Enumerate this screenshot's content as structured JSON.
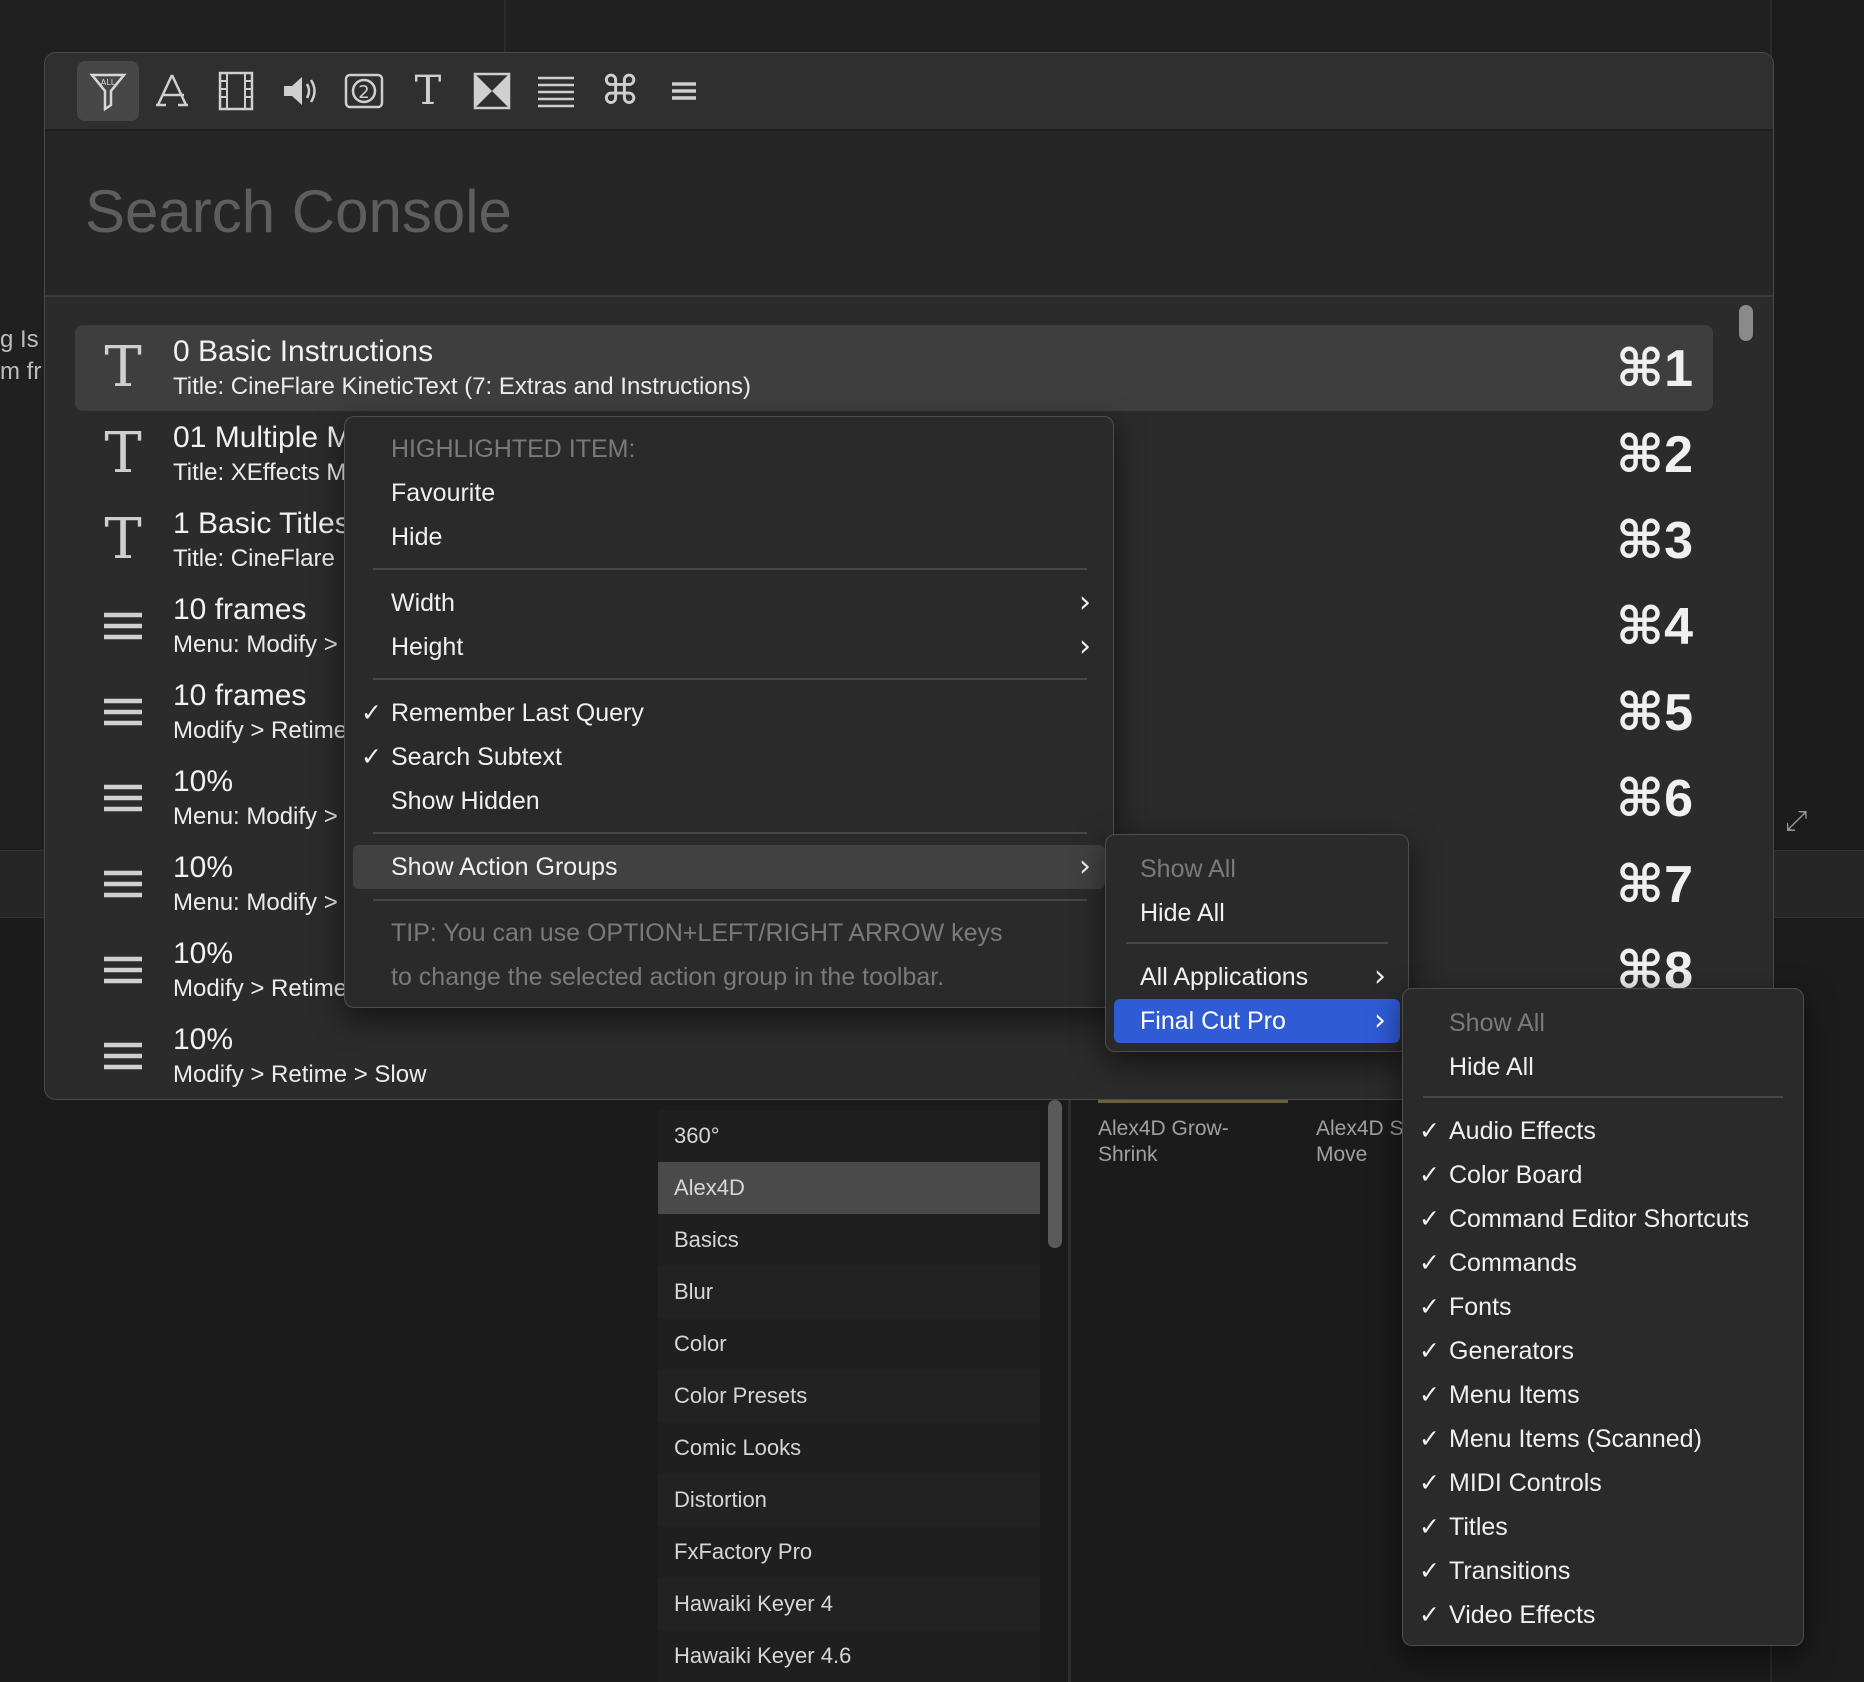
{
  "background": {
    "left_fragments": [
      "g Is",
      "m fr"
    ],
    "browser_list": [
      "360°",
      "Alex4D",
      "Basics",
      "Blur",
      "Color",
      "Color Presets",
      "Comic Looks",
      "Distortion",
      "FxFactory Pro",
      "Hawaiki Keyer 4",
      "Hawaiki Keyer 4.6"
    ],
    "browser_selected": "Alex4D",
    "thumbs": [
      {
        "line1": "Alex4D Grow-",
        "line2": "Shrink"
      },
      {
        "line1": "Alex4D S",
        "line2": "Move"
      }
    ]
  },
  "toolbar": {
    "buttons": [
      {
        "name": "all-filter-icon",
        "active": true
      },
      {
        "name": "app-store-icon"
      },
      {
        "name": "film-strip-icon"
      },
      {
        "name": "speaker-icon"
      },
      {
        "name": "generator-icon"
      },
      {
        "name": "title-icon"
      },
      {
        "name": "transition-icon"
      },
      {
        "name": "text-lines-icon"
      },
      {
        "name": "command-icon"
      },
      {
        "name": "menu-icon"
      }
    ]
  },
  "search": {
    "placeholder": "Search Console",
    "value": ""
  },
  "results": [
    {
      "icon": "T",
      "title": "0 Basic Instructions",
      "subtitle": "Title: CineFlare KineticText (7: Extras and Instructions)",
      "shortcut": "⌘1"
    },
    {
      "icon": "T",
      "title": "01 Multiple M",
      "subtitle": "Title: XEffects M",
      "shortcut": "⌘2"
    },
    {
      "icon": "T",
      "title": "1 Basic Titles",
      "subtitle": "Title: CineFlare",
      "shortcut": "⌘3"
    },
    {
      "icon": "menu",
      "title": "10 frames",
      "subtitle": "Menu: Modify >",
      "shortcut": "⌘4"
    },
    {
      "icon": "menu",
      "title": "10 frames",
      "subtitle": "Modify > Retime",
      "shortcut": "⌘5"
    },
    {
      "icon": "menu",
      "title": "10%",
      "subtitle": "Menu: Modify >",
      "shortcut": "⌘6"
    },
    {
      "icon": "menu",
      "title": "10%",
      "subtitle": "Menu: Modify >",
      "shortcut": "⌘7"
    },
    {
      "icon": "menu",
      "title": "10%",
      "subtitle": "Modify > Retime",
      "shortcut": "⌘8"
    },
    {
      "icon": "menu",
      "title": "10%",
      "subtitle": "Modify > Retime > Slow",
      "shortcut": ""
    }
  ],
  "context_menu": {
    "header": "HIGHLIGHTED ITEM:",
    "favourite": "Favourite",
    "hide": "Hide",
    "width": "Width",
    "height": "Height",
    "remember_last_query": "Remember Last Query",
    "search_subtext": "Search Subtext",
    "show_hidden": "Show Hidden",
    "show_action_groups": "Show Action Groups",
    "tip_line1": "TIP: You can use OPTION+LEFT/RIGHT ARROW keys",
    "tip_line2": "to change the selected action group in the toolbar.",
    "check": "✓",
    "arrow": "›"
  },
  "action_groups_menu": {
    "show_all": "Show All",
    "hide_all": "Hide All",
    "all_applications": "All Applications",
    "final_cut_pro": "Final Cut Pro"
  },
  "fcp_menu": {
    "show_all": "Show All",
    "hide_all": "Hide All",
    "items": [
      "Audio Effects",
      "Color Board",
      "Command Editor Shortcuts",
      "Commands",
      "Fonts",
      "Generators",
      "Menu Items",
      "Menu Items (Scanned)",
      "MIDI Controls",
      "Titles",
      "Transitions",
      "Video Effects"
    ]
  },
  "colors": {
    "highlight_blue": "#2f5bd5",
    "window_bg": "#2b2b2b"
  }
}
